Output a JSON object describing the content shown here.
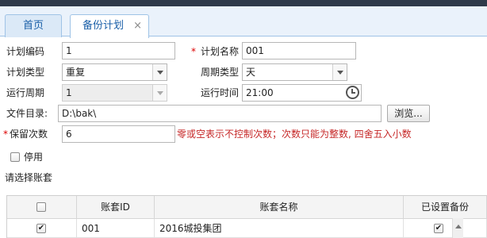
{
  "tabs": {
    "home": "首页",
    "active": "备份计划",
    "close_glyph": "×"
  },
  "form": {
    "plan_code_label": "计划编码",
    "plan_code_value": "1",
    "required_mark": "*",
    "plan_name_label": "计划名称",
    "plan_name_value": "001",
    "plan_type_label": "计划类型",
    "plan_type_value": "重复",
    "period_type_label": "周期类型",
    "period_type_value": "天",
    "run_period_label": "运行周期",
    "run_period_value": "1",
    "run_time_label": "运行时间",
    "run_time_value": "21:00",
    "dir_label": "文件目录:",
    "dir_value": "D:\\bak\\",
    "browse_label": "浏览...",
    "keep_count_label": "保留次数",
    "keep_count_value": "6",
    "keep_hint": "零或空表示不控制次数；次数只能为整数, 四舍五入小数",
    "disable_label": "停用",
    "select_account_label": "请选择账套"
  },
  "grid": {
    "headers": {
      "check": "",
      "id": "账套ID",
      "name": "账套名称",
      "backup": "已设置备份"
    },
    "rows": [
      {
        "checked": "✔",
        "id": "001",
        "name": "2016城投集团",
        "backup": "✔"
      }
    ]
  },
  "colors": {
    "accent": "#1a5fa8",
    "hint_red": "#c62828",
    "tab_bg": "#eaf2fb"
  },
  "icons": {
    "close": "close-icon",
    "dropdown": "chevron-down-icon",
    "clock": "clock-icon",
    "checkbox": "checkbox-icon"
  }
}
